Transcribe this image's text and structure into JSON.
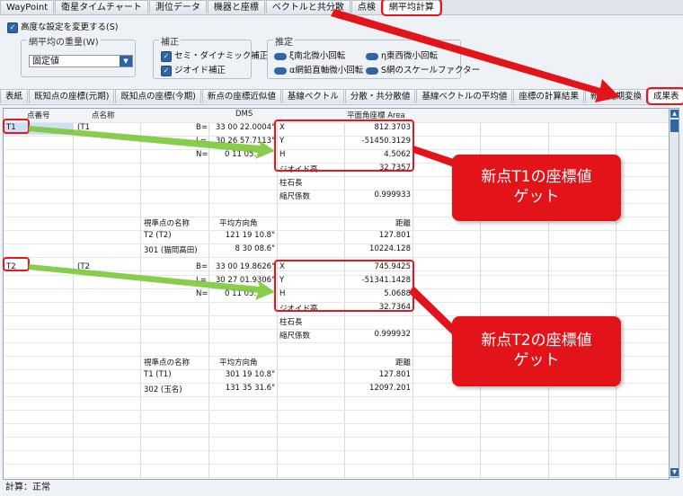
{
  "top_tabs": [
    "WayPoint",
    "衛星タイムチャート",
    "測位データ",
    "機器と座標",
    "ベクトルと共分散",
    "点検",
    "網平均計算"
  ],
  "options": {
    "advanced_label": "高度な設定を変更する(S)",
    "weight_group": "網平均の重量(W)",
    "weight_value": "固定値",
    "correction_group": "補正",
    "corrections": [
      "セミ・ダイナミック補正",
      "ジオイド補正"
    ],
    "estimate_group": "推定",
    "estimates": [
      "ξ南北微小回転",
      "η東西微小回転",
      "α網鉛直軸微小回転",
      "S網のスケールファクター"
    ]
  },
  "sub_tabs": [
    "表紙",
    "既知点の座標(元期)",
    "既知点の座標(今期)",
    "新点の座標近似値",
    "基線ベクトル",
    "分散・共分散値",
    "基線ベクトルの平均値",
    "座標の計算結果",
    "新点元期変換",
    "成果表"
  ],
  "table": {
    "headers": [
      "点番号",
      "点名称",
      "DMS",
      "",
      "",
      "平面角座標 Area"
    ],
    "blocks": [
      {
        "id": "T1",
        "name": "(T1",
        "B": "33 00 22.0004\"",
        "L": "30 26 57.7113\"",
        "N": "0 11 05.",
        "X": "812.3703",
        "Y": "-51450.3129",
        "H": "4.5062",
        "geoid_label": "ジオイド高",
        "geoid": "32.7357",
        "pillar": "柱石長",
        "scale_label": "縮尺係数",
        "scale": "0.999933",
        "sight_hdr": "視準点の名称",
        "dir_hdr": "平均方向角",
        "dist_hdr": "距離",
        "targets": [
          {
            "name": "T2 (T2)",
            "dir": "121 19 10.8\"",
            "dist": "127.801"
          },
          {
            "name": "301 (猫岡高田)",
            "dir": "8 30 08.6\"",
            "dist": "10224.128"
          }
        ]
      },
      {
        "id": "T2",
        "name": "(T2",
        "B": "33 00 19.8626\"",
        "L": "30 27 01.9306\"",
        "N": "0 11 05.",
        "X": "745.9425",
        "Y": "-51341.1428",
        "H": "5.0688",
        "geoid_label": "ジオイド高",
        "geoid": "32.7364",
        "pillar": "柱石長",
        "scale_label": "縮尺係数",
        "scale": "0.999932",
        "sight_hdr": "視準点の名称",
        "dir_hdr": "平均方向角",
        "dist_hdr": "距離",
        "targets": [
          {
            "name": "T1 (T1)",
            "dir": "301 19 10.8\"",
            "dist": "127.801"
          },
          {
            "name": "302 (玉名)",
            "dir": "131 35 31.6\"",
            "dist": "12097.201"
          }
        ]
      }
    ]
  },
  "callouts": [
    "新点T1の座標値\nゲット",
    "新点T2の座標値\nゲット"
  ],
  "status": "計算：正常",
  "colors": {
    "accent": "#e2141a",
    "arrow_green": "#7cc83a",
    "ui_blue": "#2f64a6"
  }
}
